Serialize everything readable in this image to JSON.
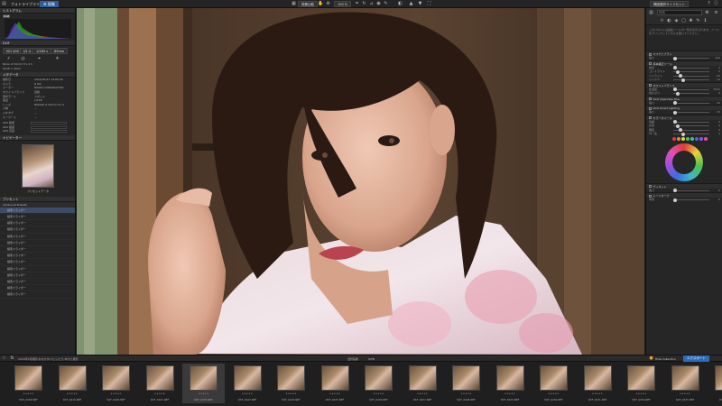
{
  "topbar": {
    "tabs": [
      "フォトライブラリ",
      "現像"
    ],
    "left_icon": "library-icon",
    "center_buttons": [
      "現像比較",
      "100 %"
    ],
    "right_button": "構図選択サイドセット"
  },
  "left": {
    "histogram_title": "ヒストグラム",
    "histogram_mode": "RGB",
    "exif_title": "EXIF",
    "exif_buttons": [
      "ISO 400",
      "f/1.4",
      "1/160 s",
      "85mm"
    ],
    "info_rows": [
      {
        "k": "Nikon Z 50mm f/1.4 S",
        "v": ""
      },
      {
        "k": "6048 × 4024",
        "v": ""
      }
    ],
    "meta_rows": [
      {
        "k": "撮影日",
        "v": "2024/05/27 14:05:28"
      },
      {
        "k": "カメラ",
        "v": "Z 6III"
      },
      {
        "k": "メーカー",
        "v": "NIKON CORPORATION"
      },
      {
        "k": "ホワイトバランス",
        "v": "自動"
      },
      {
        "k": "測光モード",
        "v": "スポット"
      },
      {
        "k": "露出",
        "v": "1/160"
      },
      {
        "k": "レンズ",
        "v": "NIKKOR Z 50mm f/1.4"
      },
      {
        "k": "人物",
        "v": "—"
      },
      {
        "k": "ジオタグ",
        "v": "—"
      },
      {
        "k": "キーワード",
        "v": "—"
      }
    ],
    "gps_rows": [
      "GPS 緯度",
      "GPS 経度",
      "GPS 高度"
    ],
    "preset_title": "ナビゲーター",
    "preview_label": "プリセットデータ",
    "presets_title": "プリセット",
    "presets_group": "Advanced Presets",
    "presets": [
      "検索スライダー",
      "検索スライダー",
      "検索スライダー",
      "検索スライダー",
      "検索スライダー",
      "検索スライダー",
      "検索スライダー",
      "検索スライダー",
      "検索スライダー",
      "検索スライダー",
      "検索スライダー",
      "検索スライダー",
      "検索スライダー",
      "検索スライダー"
    ]
  },
  "right": {
    "search_placeholder": "検索",
    "note": "このパネルには編集ツールの一覧が表示されます。ツールをクリックしてパネルを開いてください。",
    "sections": [
      {
        "title": "マスクとブラシ",
        "sliders": [
          {
            "label": "強さ",
            "value": "100"
          }
        ]
      },
      {
        "title": "基本補正ツール",
        "sliders": [
          {
            "label": "露出",
            "value": "0"
          },
          {
            "label": "コントラスト",
            "value": "0"
          },
          {
            "label": "ハイライト",
            "value": "-22"
          },
          {
            "label": "シャドウ",
            "value": "14"
          }
        ]
      },
      {
        "title": "ホワイトバランス",
        "sliders": [
          {
            "label": "色温度",
            "value": "5500"
          },
          {
            "label": "色かぶり",
            "value": "0"
          }
        ]
      },
      {
        "title": "DxO ClearView Plus",
        "sliders": [
          {
            "label": "強さ",
            "value": "20"
          }
        ]
      },
      {
        "title": "DxO Smart Lighting",
        "sliders": [
          {
            "label": "強さ",
            "value": "25"
          }
        ]
      },
      {
        "title": "カラーホイール",
        "sliders": [
          {
            "label": "色相",
            "value": "0"
          },
          {
            "label": "彩度",
            "value": "0"
          },
          {
            "label": "輝度",
            "value": "0"
          },
          {
            "label": "均一性",
            "value": "0"
          }
        ]
      },
      {
        "title": "ヴィネット",
        "sliders": [
          {
            "label": "強さ",
            "value": "0"
          }
        ]
      },
      {
        "title": "トーンカーブ",
        "sliders": [
          {
            "label": "中間",
            "value": "0"
          }
        ]
      }
    ],
    "swatch_colors": [
      "#e23b3b",
      "#e88a2c",
      "#e6d23a",
      "#4cc24c",
      "#3fb6c8",
      "#3b6de2",
      "#9a4fe2",
      "#e24fb3"
    ]
  },
  "filmbar": {
    "folder_path": "2024年5月撮影/おなかすいた/ふたり/ゆかた撮影",
    "count": "選択画像",
    "count_value": "1/76",
    "collection": "Hide Collection",
    "export_button": "エクスポート"
  },
  "thumbnails": [
    {
      "name": "DSF_0218.NEF"
    },
    {
      "name": "DSF_0219.NEF"
    },
    {
      "name": "DSF_0220.NEF"
    },
    {
      "name": "DSF_0221.NEF"
    },
    {
      "name": "DSF_0222.NEF"
    },
    {
      "name": "DSF_0223.NEF"
    },
    {
      "name": "DSF_0224.NEF"
    },
    {
      "name": "DSF_0225.NEF"
    },
    {
      "name": "DSF_0226.NEF"
    },
    {
      "name": "DSF_0227.NEF"
    },
    {
      "name": "DSF_0228.NEF"
    },
    {
      "name": "DSF_0229.NEF"
    },
    {
      "name": "DSF_0230.NEF"
    },
    {
      "name": "DSF_0231.NEF"
    },
    {
      "name": "DSF_0232.NEF"
    },
    {
      "name": "DSF_0233.NEF"
    },
    {
      "name": "DSF_0234.NEF"
    }
  ],
  "selected_thumb": 4,
  "stars": "★★★★★"
}
